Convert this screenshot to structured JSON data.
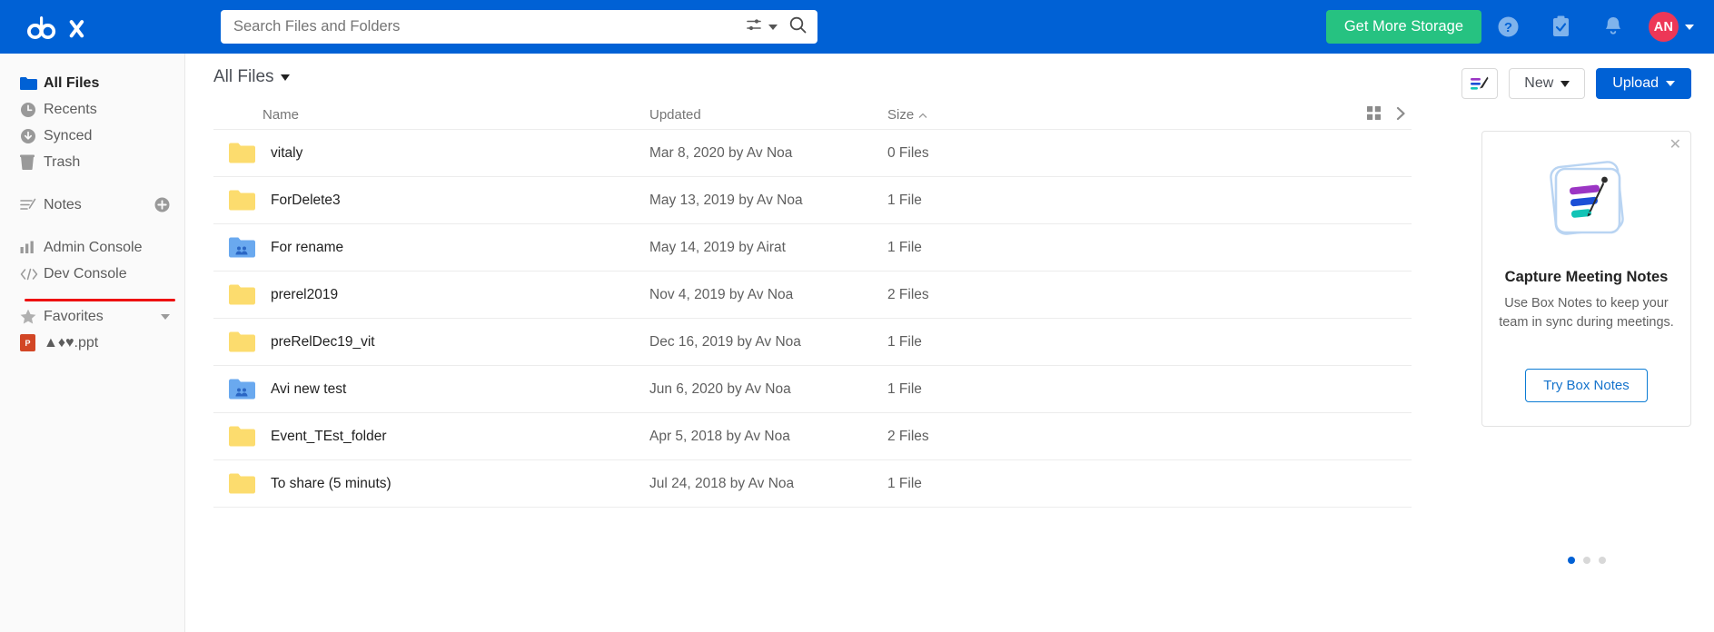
{
  "topnav": {
    "logo_text": "box",
    "search": {
      "placeholder": "Search Files and Folders",
      "value": "",
      "filter_icon": "filter-sliders-icon",
      "search_icon": "search-icon"
    },
    "storage_button": "Get More Storage",
    "help_icon": "help-circle-icon",
    "tasks_icon": "clipboard-check-icon",
    "notifications_icon": "bell-icon",
    "avatar_initials": "AN",
    "accent_blue": "#0061d5",
    "accent_green": "#26c281",
    "avatar_color": "#ed3757"
  },
  "sidebar": {
    "items": [
      {
        "label": "All Files",
        "icon": "folder-icon",
        "active": true
      },
      {
        "label": "Recents",
        "icon": "clock-icon",
        "active": false
      },
      {
        "label": "Synced",
        "icon": "sync-down-arrow-icon",
        "active": false
      },
      {
        "label": "Trash",
        "icon": "trash-icon",
        "active": false
      }
    ],
    "notes": {
      "label": "Notes",
      "icon": "notes-icon",
      "add_icon": "plus-circle-icon"
    },
    "consoles": [
      {
        "label": "Admin Console",
        "icon": "bar-chart-icon",
        "highlighted": true
      },
      {
        "label": "Dev Console",
        "icon": "code-brackets-icon",
        "highlighted": false
      }
    ],
    "favorites": {
      "label": "Favorites",
      "icon": "star-icon",
      "collapse_icon": "chevron-down-icon"
    },
    "favorite_files": [
      {
        "label": "▲♦♥.ppt",
        "icon": "powerpoint-file-icon",
        "badge": "P"
      }
    ],
    "highlight_color": "#ee1111"
  },
  "main": {
    "breadcrumb": "All Files",
    "breadcrumb_caret": "caret-down-icon",
    "notes_button_icon": "box-notes-icon",
    "new_button": "New",
    "upload_button": "Upload",
    "columns": {
      "name": "Name",
      "updated": "Updated",
      "size": "Size"
    },
    "sort": {
      "column": "Size",
      "direction_icon": "caret-up-icon"
    },
    "view_toggle_icon": "grid-view-icon",
    "expand_icon": "chevron-right-icon",
    "rows": [
      {
        "name": "vitaly",
        "updated": "Mar 8, 2020 by Av Noa",
        "size": "0 Files",
        "type": "folder"
      },
      {
        "name": "ForDelete3",
        "updated": "May 13, 2019 by Av Noa",
        "size": "1 File",
        "type": "folder"
      },
      {
        "name": "For rename",
        "updated": "May 14, 2019 by Airat",
        "size": "1 File",
        "type": "shared-folder"
      },
      {
        "name": "prerel2019",
        "updated": "Nov 4, 2019 by Av Noa",
        "size": "2 Files",
        "type": "folder"
      },
      {
        "name": "preRelDec19_vit",
        "updated": "Dec 16, 2019 by Av Noa",
        "size": "1 File",
        "type": "folder"
      },
      {
        "name": "Avi new test",
        "updated": "Jun 6, 2020 by Av Noa",
        "size": "1 File",
        "type": "shared-folder"
      },
      {
        "name": "Event_TEst_folder",
        "updated": "Apr 5, 2018 by Av Noa",
        "size": "2 Files",
        "type": "folder"
      },
      {
        "name": "To share (5 minuts)",
        "updated": "Jul 24, 2018 by Av Noa",
        "size": "1 File",
        "type": "folder"
      }
    ]
  },
  "promo": {
    "close_icon": "close-icon",
    "illustration": "box-notes-illustration",
    "title": "Capture Meeting Notes",
    "text": "Use Box Notes to keep your team in sync during meetings.",
    "button": "Try Box Notes",
    "dots": 3,
    "active_dot": 0
  }
}
